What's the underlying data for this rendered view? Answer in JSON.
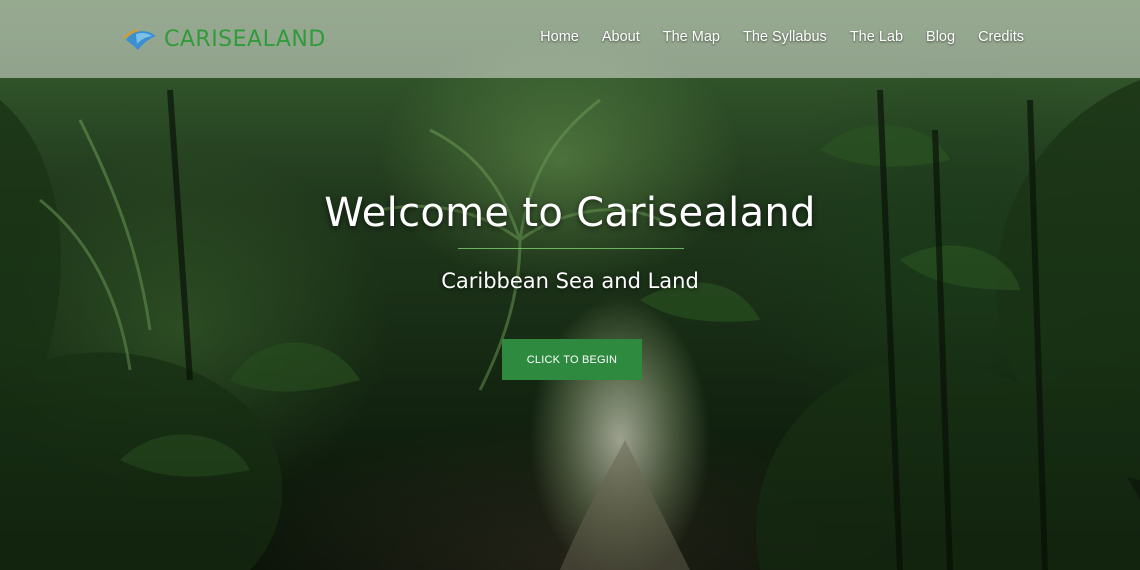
{
  "header": {
    "logo_text": "CARISEALAND",
    "nav": [
      {
        "label": "Home"
      },
      {
        "label": "About"
      },
      {
        "label": "The Map"
      },
      {
        "label": "The Syllabus"
      },
      {
        "label": "The Lab"
      },
      {
        "label": "Blog"
      },
      {
        "label": "Credits"
      }
    ]
  },
  "hero": {
    "title": "Welcome to Carisealand",
    "subtitle": "Caribbean Sea and Land",
    "cta_label": "CLICK TO BEGIN"
  },
  "colors": {
    "accent": "#2e8a3f",
    "logo_green": "#2f9b3a",
    "logo_blue": "#3a8fd0",
    "header_overlay": "#e1e4de"
  },
  "icons": {
    "logo": "sea-turtle-logo-icon"
  }
}
